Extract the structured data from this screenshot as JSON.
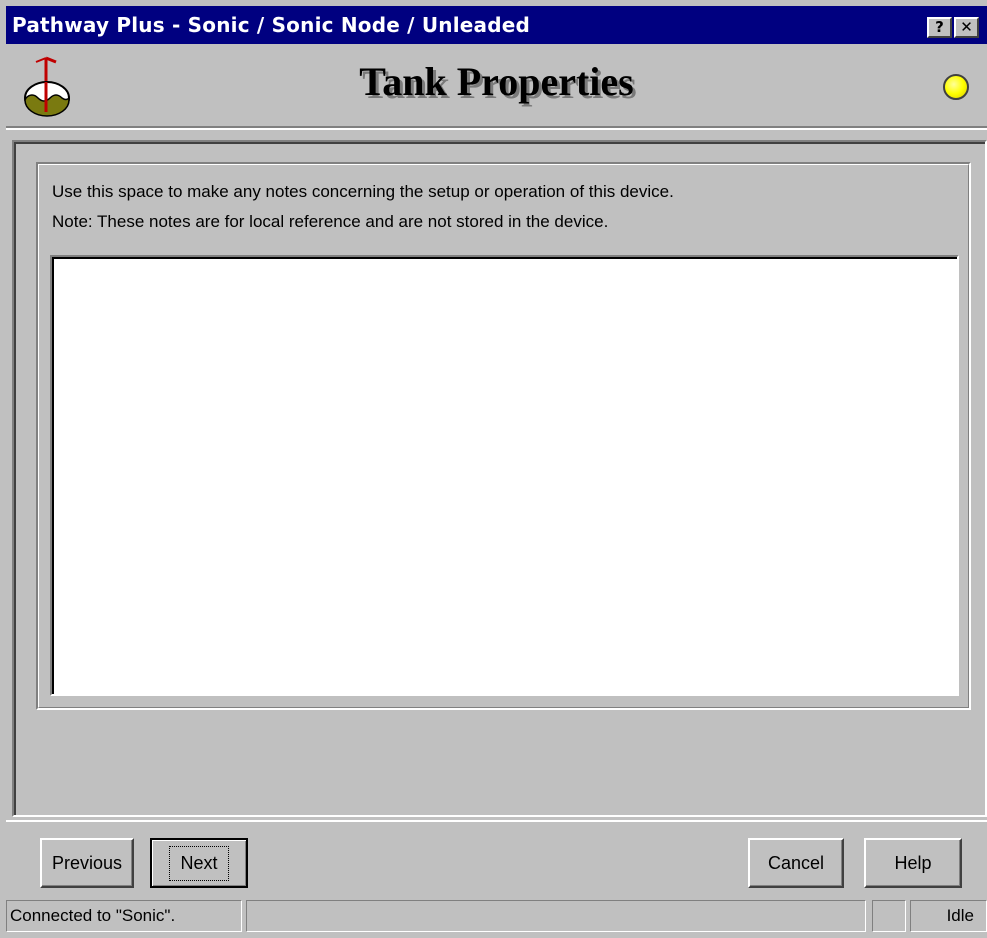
{
  "window": {
    "title": "Pathway Plus - Sonic / Sonic Node / Unleaded",
    "help_button": "?",
    "close_button": "✕"
  },
  "header": {
    "title": "Tank Properties",
    "icon": "tank-icon",
    "status_indicator_color": "#ffff00"
  },
  "notes": {
    "instruction_line1": "Use this space to make any notes concerning the setup or operation of this device.",
    "instruction_line2": "Note: These notes are for local reference and are not stored in the device.",
    "value": ""
  },
  "buttons": {
    "previous": "Previous",
    "next": "Next",
    "cancel": "Cancel",
    "help": "Help"
  },
  "status_bar": {
    "connection": "Connected to \"Sonic\".",
    "middle": "",
    "small": "",
    "state": "Idle"
  },
  "colors": {
    "title_bar": "#000080",
    "face": "#c0c0c0",
    "notes_background": "#ffffff"
  }
}
